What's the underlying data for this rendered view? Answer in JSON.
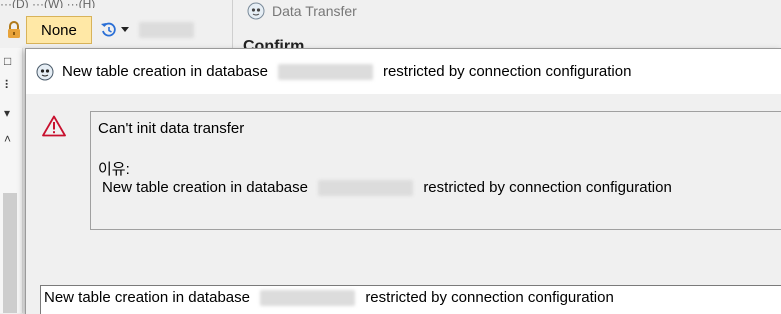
{
  "app": {
    "menu_text": "···(D)  ···(W)  ···(H)",
    "none_label": "None"
  },
  "data_transfer": {
    "title": "Data Transfer",
    "confirm_heading": "Confirm"
  },
  "dialog": {
    "title_prefix": "New table creation in database",
    "title_suffix": "restricted by connection configuration",
    "error_title": "Can't init data transfer",
    "reason_label": "이유:",
    "message_prefix": "New table creation in database",
    "message_suffix": "restricted by connection configuration",
    "field_prefix": "New table creation in database",
    "field_suffix": "restricted by connection configuration"
  },
  "colors": {
    "warning": "#c8102e",
    "none_button_bg": "#ffe8a6",
    "lock": "#e8a33a",
    "history": "#2a6fd6"
  }
}
